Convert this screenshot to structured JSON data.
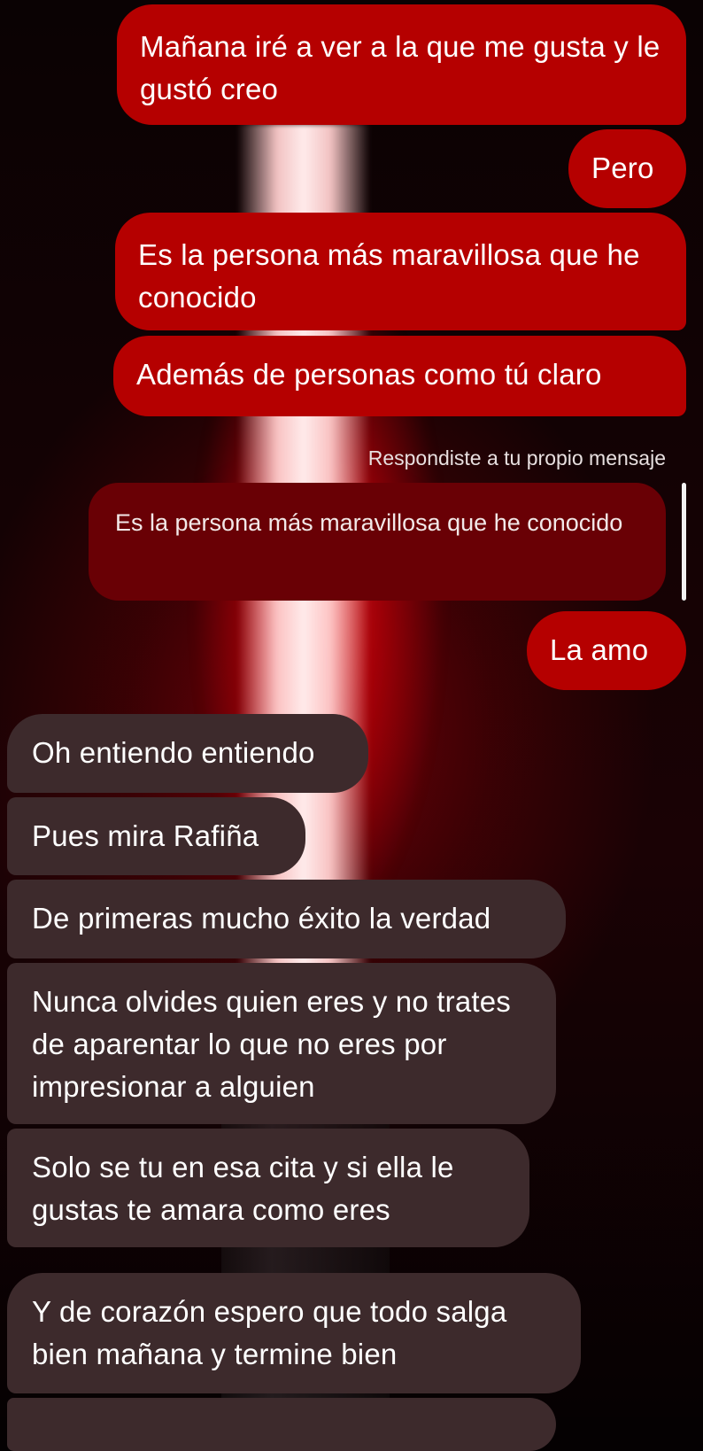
{
  "conversation": {
    "sent_messages": [
      "Mañana iré a ver a la que me gusta y le gustó creo",
      "Pero",
      "Es la persona más maravillosa que he conocido",
      "Además de personas como tú claro"
    ],
    "reply": {
      "label": "Respondiste a tu propio mensaje",
      "quoted_text": "Es la persona más maravillosa que he conocido",
      "text": "La amo"
    },
    "received_messages": [
      "Oh entiendo entiendo",
      "Pues mira Rafiña",
      "De primeras mucho éxito la verdad",
      "Nunca olvides quien eres y no trates de aparentar lo que no eres por impresionar a alguien",
      "Solo se tu en esa cita y si ella le gustas te amara como eres",
      "Y de corazón espero que todo salga bien mañana y termine bien"
    ]
  },
  "theme": {
    "sent_bubble_color": "#b50000",
    "received_bubble_color": "#3d2a2c",
    "quoted_bubble_color": "#690005",
    "text_color": "#ffffff",
    "wallpaper": "red lightsaber on dark background"
  }
}
